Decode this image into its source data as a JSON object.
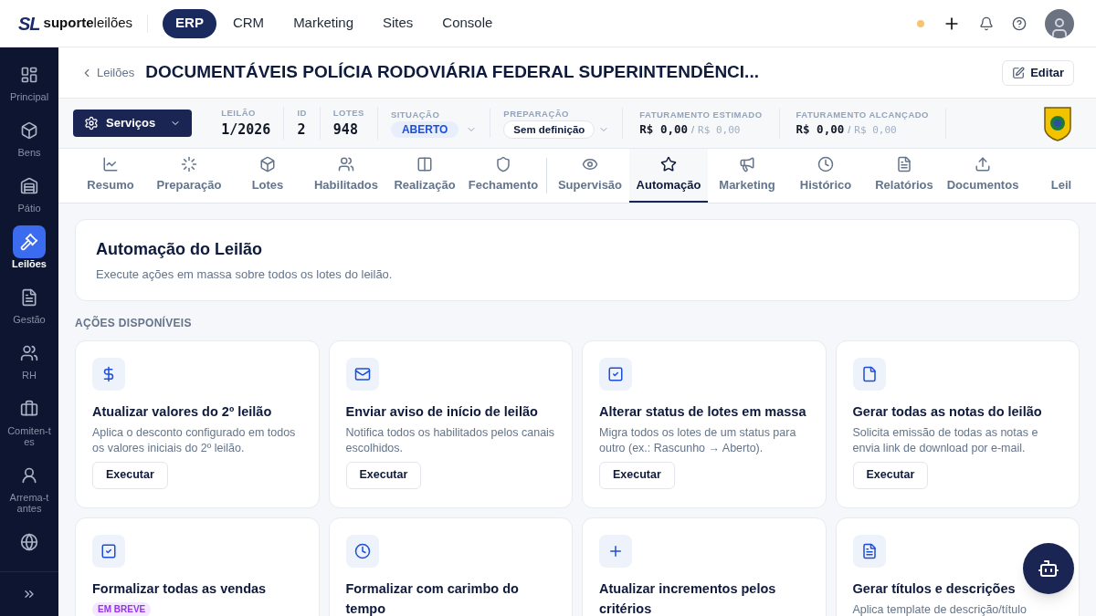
{
  "top_nav": {
    "logo": {
      "mark": "SL",
      "brand_bold": "suporte",
      "brand_light": "leilões"
    },
    "apps": [
      {
        "label": "ERP",
        "selected": true
      },
      {
        "label": "CRM",
        "selected": false
      },
      {
        "label": "Marketing",
        "selected": false
      },
      {
        "label": "Sites",
        "selected": false
      },
      {
        "label": "Console",
        "selected": false
      }
    ]
  },
  "sidebar": {
    "items": [
      {
        "label": "Principal",
        "selected": false
      },
      {
        "label": "Bens",
        "selected": false
      },
      {
        "label": "Pátio",
        "selected": false
      },
      {
        "label": "Leilões",
        "selected": true
      },
      {
        "label": "Gestão",
        "selected": false
      },
      {
        "label": "RH",
        "selected": false
      },
      {
        "label": "Comiten-tes",
        "selected": false
      },
      {
        "label": "Arrema-tantes",
        "selected": false
      },
      {
        "selected": false
      }
    ]
  },
  "header": {
    "back_link": "Leilões",
    "title": "DOCUMENTÁVEIS POLÍCIA RODOVIÁRIA FEDERAL SUPERINTENDÊNCI...",
    "edit_button": "Editar"
  },
  "info_bar": {
    "services_button": "Serviços",
    "fields": [
      {
        "label": "LEILÃO",
        "value": "1/2026"
      },
      {
        "label": "ID",
        "value": "2"
      },
      {
        "label": "LOTES",
        "value": "948"
      }
    ],
    "situation": {
      "label": "SITUAÇÃO",
      "value": "ABERTO"
    },
    "preparation": {
      "label": "PREPARAÇÃO",
      "value": "Sem definição"
    },
    "revenues": [
      {
        "label": "FATURAMENTO ESTIMADO",
        "value": "R$ 0,00",
        "separator": "/",
        "total": "R$ 0,00"
      },
      {
        "label": "FATURAMENTO ALCANÇADO",
        "value": "R$ 0,00",
        "separator": "/",
        "total": "R$ 0,00"
      }
    ]
  },
  "tabs": [
    {
      "label": "Resumo",
      "selected": false,
      "divider_before": false
    },
    {
      "label": "Preparação",
      "selected": false,
      "divider_before": false
    },
    {
      "label": "Lotes",
      "selected": false,
      "divider_before": false
    },
    {
      "label": "Habilitados",
      "selected": false,
      "divider_before": false
    },
    {
      "label": "Realização",
      "selected": false,
      "divider_before": false
    },
    {
      "label": "Fechamento",
      "selected": false,
      "divider_before": false
    },
    {
      "label": "Supervisão",
      "selected": false,
      "divider_before": true
    },
    {
      "label": "Automação",
      "selected": true,
      "divider_before": false
    },
    {
      "label": "Marketing",
      "selected": false,
      "divider_before": false
    },
    {
      "label": "Histórico",
      "selected": false,
      "divider_before": false
    },
    {
      "label": "Relatórios",
      "selected": false,
      "divider_before": false
    },
    {
      "label": "Documentos",
      "selected": false,
      "divider_before": false
    },
    {
      "label": "Leil",
      "selected": false,
      "divider_before": false
    }
  ],
  "panel": {
    "title": "Automação do Leilão",
    "subtitle": "Execute ações em massa sobre todos os lotes do leilão."
  },
  "section_label": "AÇÕES DISPONÍVEIS",
  "actions": [
    {
      "title": "Atualizar valores do 2º leilão",
      "description": "Aplica o desconto configurado em todos os valores iniciais do 2º leilão.",
      "button": "Executar"
    },
    {
      "title": "Enviar aviso de início de leilão",
      "description": "Notifica todos os habilitados pelos canais escolhidos.",
      "button": "Executar"
    },
    {
      "title": "Alterar status de lotes em massa",
      "description": "Migra todos os lotes de um status para outro (ex.: Rascunho → Aberto).",
      "button": "Executar"
    },
    {
      "title": "Gerar todas as notas do leilão",
      "description": "Solicita emissão de todas as notas e envia link de download por e-mail.",
      "button": "Executar"
    },
    {
      "title": "Formalizar todas as vendas",
      "badge": "EM BREVE"
    },
    {
      "title": "Formalizar com carimbo do tempo"
    },
    {
      "title": "Atualizar incrementos pelos critérios"
    },
    {
      "title": "Gerar títulos e descrições",
      "description": "Aplica template de descrição/título"
    }
  ]
}
